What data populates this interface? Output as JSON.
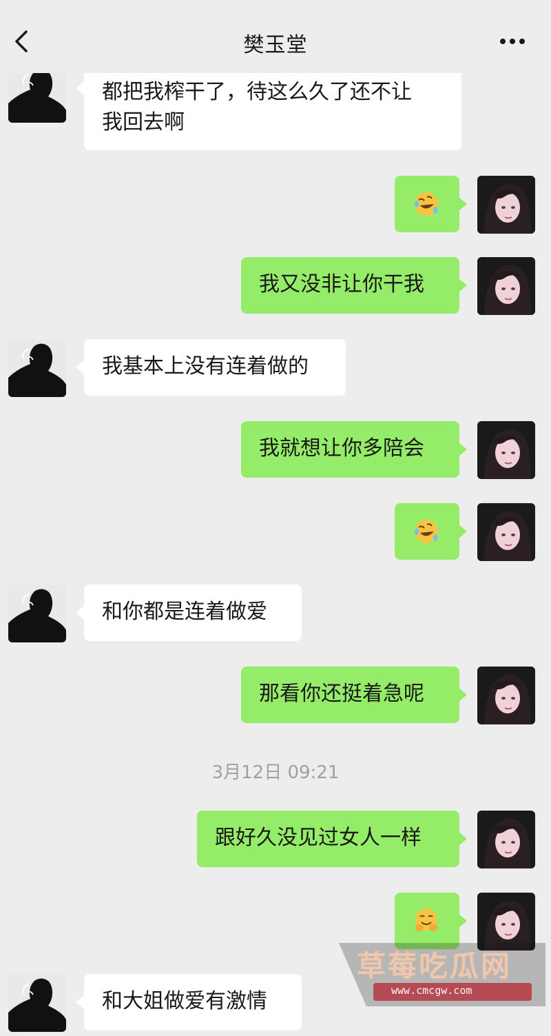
{
  "header": {
    "title": "樊玉堂",
    "back_icon": "chevron-left-icon",
    "more_icon": "more-dots-icon"
  },
  "messages": [
    {
      "side": "in",
      "text": "都把我榨干了，待这么久了还不让\n我回去啊"
    },
    {
      "side": "out",
      "emoji": "rolling-laughing-emoji"
    },
    {
      "side": "out",
      "text": "我又没非让你干我"
    },
    {
      "side": "in",
      "text": "我基本上没有连着做的"
    },
    {
      "side": "out",
      "text": "我就想让你多陪会"
    },
    {
      "side": "out",
      "emoji": "rolling-laughing-emoji"
    },
    {
      "side": "in",
      "text": "和你都是连着做爱"
    },
    {
      "side": "out",
      "text": "那看你还挺着急呢"
    },
    {
      "side": "out",
      "text": "跟好久没见过女人一样"
    },
    {
      "side": "out",
      "emoji": "hugging-face-emoji"
    },
    {
      "side": "in",
      "text": "和大姐做爱有激情"
    }
  ],
  "timestamp": "3月12日 09:21",
  "watermark": {
    "name": "草莓吃瓜网",
    "url": "www.cmcgw.com"
  },
  "colors": {
    "background": "#ededed",
    "outgoing_bubble": "#95ec69",
    "incoming_bubble": "#ffffff"
  }
}
